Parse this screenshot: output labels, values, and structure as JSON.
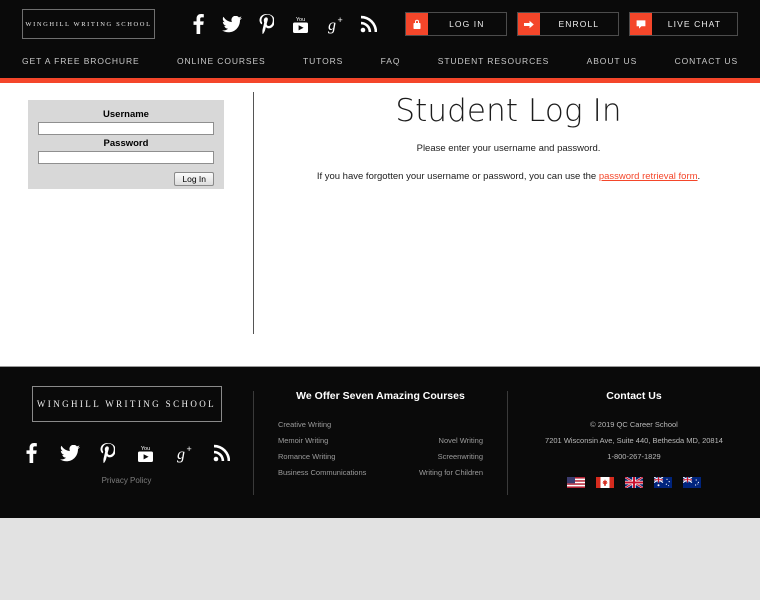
{
  "header": {
    "logo_text": "WINGHILL WRITING SCHOOL",
    "social": [
      {
        "name": "facebook-icon",
        "label": "Facebook"
      },
      {
        "name": "twitter-icon",
        "label": "Twitter"
      },
      {
        "name": "pinterest-icon",
        "label": "Pinterest"
      },
      {
        "name": "youtube-icon",
        "label": "YouTube"
      },
      {
        "name": "googleplus-icon",
        "label": "Google Plus"
      },
      {
        "name": "rss-icon",
        "label": "RSS"
      }
    ],
    "buttons": [
      {
        "label": "LOG IN",
        "icon": "lock-icon",
        "color": "#f4462a"
      },
      {
        "label": "ENROLL",
        "icon": "arrow-right-icon",
        "color": "#f4462a"
      },
      {
        "label": "LIVE CHAT",
        "icon": "chat-bubble-icon",
        "color": "#f4462a"
      }
    ],
    "nav": [
      "GET A FREE BROCHURE",
      "ONLINE COURSES",
      "TUTORS",
      "FAQ",
      "STUDENT RESOURCES",
      "ABOUT US",
      "CONTACT US"
    ],
    "accent_color": "#f4462a",
    "background_color": "#0a0a0a"
  },
  "login_form": {
    "username_label": "Username",
    "username_value": "",
    "password_label": "Password",
    "password_value": "",
    "submit_label": "Log In",
    "panel_color": "#d8d8d8"
  },
  "main": {
    "title": "Student Log In",
    "subtitle": "Please enter your username and password.",
    "retrieval_prefix": "If you have forgotten your username or password, you can use the ",
    "retrieval_link": "password retrieval form",
    "retrieval_suffix": ".",
    "link_color": "#f4462a"
  },
  "footer": {
    "logo_text": "WINGHILL WRITING SCHOOL",
    "social": [
      {
        "name": "facebook-icon",
        "label": "Facebook"
      },
      {
        "name": "twitter-icon",
        "label": "Twitter"
      },
      {
        "name": "pinterest-icon",
        "label": "Pinterest"
      },
      {
        "name": "youtube-icon",
        "label": "YouTube"
      },
      {
        "name": "googleplus-icon",
        "label": "Google Plus"
      },
      {
        "name": "rss-icon",
        "label": "RSS"
      }
    ],
    "privacy_label": "Privacy Policy",
    "courses_heading": "We Offer Seven Amazing Courses",
    "courses_left": [
      "Creative Writing",
      "Memoir Writing",
      "Romance Writing",
      "Business Communications"
    ],
    "courses_right": [
      "",
      "Novel Writing",
      "Screenwriting",
      "Writing for Children"
    ],
    "contact_heading": "Contact Us",
    "contact_copyright": "© 2019 QC Career School",
    "contact_address": "7201 Wisconsin Ave, Suite 440, Bethesda MD, 20814",
    "contact_phone": "1-800-267-1829",
    "flags": [
      {
        "name": "flag-usa",
        "label": "United States"
      },
      {
        "name": "flag-canada",
        "label": "Canada"
      },
      {
        "name": "flag-uk",
        "label": "United Kingdom"
      },
      {
        "name": "flag-australia",
        "label": "Australia"
      },
      {
        "name": "flag-newzealand",
        "label": "New Zealand"
      }
    ]
  }
}
